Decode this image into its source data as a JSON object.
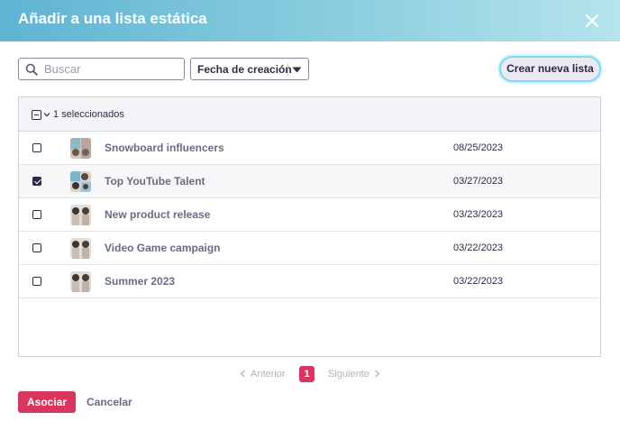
{
  "dialog": {
    "title": "Añadir a una lista estática",
    "close_icon": "close-icon"
  },
  "toolbar": {
    "search_placeholder": "Buscar",
    "search_value": "",
    "sort_label": "Fecha de creación",
    "create_label": "Crear nueva lista"
  },
  "table": {
    "selected_label": "1 seleccionados",
    "rows": [
      {
        "name": "Snowboard influencers",
        "date": "08/25/2023",
        "checked": false
      },
      {
        "name": "Top YouTube Talent",
        "date": "03/27/2023",
        "checked": true
      },
      {
        "name": "New product release",
        "date": "03/23/2023",
        "checked": false
      },
      {
        "name": "Video Game campaign",
        "date": "03/22/2023",
        "checked": false
      },
      {
        "name": "Summer 2023",
        "date": "03/22/2023",
        "checked": false
      }
    ]
  },
  "pagination": {
    "prev_label": "Anterior",
    "current_page": "1",
    "next_label": "Siguiente"
  },
  "footer": {
    "associate_label": "Asociar",
    "cancel_label": "Cancelar"
  },
  "colors": {
    "accent": "#d9365f",
    "header_start": "#5fb4d3",
    "header_end": "#b6e4ec",
    "text_dark": "#2f2a44",
    "text_muted": "#6d6a80"
  }
}
